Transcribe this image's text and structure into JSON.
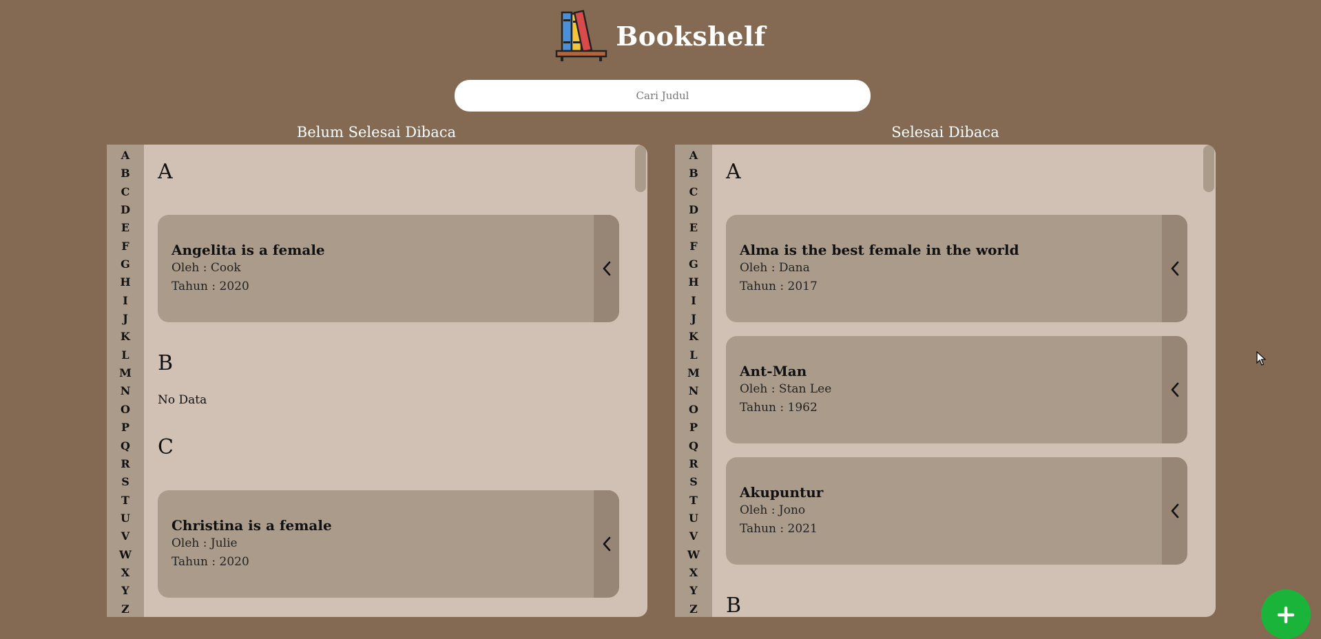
{
  "header": {
    "title": "Bookshelf"
  },
  "search": {
    "placeholder": "Cari Judul"
  },
  "alphabet": [
    "A",
    "B",
    "C",
    "D",
    "E",
    "F",
    "G",
    "H",
    "I",
    "J",
    "K",
    "L",
    "M",
    "N",
    "O",
    "P",
    "Q",
    "R",
    "S",
    "T",
    "U",
    "V",
    "W",
    "X",
    "Y",
    "Z"
  ],
  "unfinished": {
    "title": "Belum Selesai Dibaca",
    "sections": [
      {
        "letter": "A",
        "books": [
          {
            "title": "Angelita is a female",
            "author": "Oleh : Cook",
            "year": "Tahun : 2020"
          }
        ]
      },
      {
        "letter": "B",
        "empty_text": "No Data"
      },
      {
        "letter": "C",
        "books": [
          {
            "title": "Christina is a female",
            "author": "Oleh : Julie",
            "year": "Tahun : 2020"
          }
        ]
      }
    ]
  },
  "finished": {
    "title": "Selesai Dibaca",
    "sections": [
      {
        "letter": "A",
        "books": [
          {
            "title": "Alma is the best female in the world",
            "author": "Oleh : Dana",
            "year": "Tahun : 2017"
          },
          {
            "title": "Ant-Man",
            "author": "Oleh : Stan Lee",
            "year": "Tahun : 1962"
          },
          {
            "title": "Akupuntur",
            "author": "Oleh : Jono",
            "year": "Tahun : 2021"
          }
        ]
      },
      {
        "letter": "B"
      }
    ]
  },
  "colors": {
    "background": "#856a53",
    "panel": "#d1c1b5",
    "sidebar": "#ab9b8b",
    "card": "#aa9b8b",
    "card_toggle": "#978575",
    "fab": "#1bb43a"
  },
  "icons": {
    "logo": "bookshelf-logo-icon",
    "card_toggle": "chevron-left-icon",
    "fab": "plus-icon"
  }
}
